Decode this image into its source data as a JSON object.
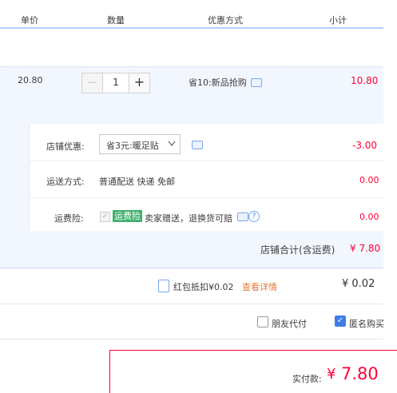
{
  "header": {
    "col_price": "单价",
    "col_qty": "数量",
    "col_discount": "优惠方式",
    "col_subtotal": "小计"
  },
  "item": {
    "price": "20.80",
    "qty": "1",
    "minus": "—",
    "plus": "+",
    "promo": "省10:新品抢购",
    "subtotal": "10.80"
  },
  "shop_discount": {
    "label": "店铺优惠:",
    "selected": "省3元:暖足贴",
    "value": "-3.00"
  },
  "shipping": {
    "label": "运送方式:",
    "method": "普通配送 快递 免邮",
    "value": "0.00"
  },
  "insurance": {
    "label": "运费险:",
    "badge": "运费险",
    "desc": "卖家赠送，退换货可赔",
    "value": "0.00"
  },
  "shop_total": {
    "label": "店铺合计(含运费)",
    "value": "¥ 7.80"
  },
  "red_envelope": {
    "label": "红包抵扣¥0.02",
    "details_link": "查看详情",
    "value": "¥ 0.02"
  },
  "options": {
    "friend_pay": "朋友代付",
    "anonymous": "匿名购买"
  },
  "payment": {
    "label": "实付款:",
    "currency": "¥",
    "amount": "7.80"
  },
  "colors": {
    "accent": "#ff0036",
    "blue": "#3f7ee8",
    "green_badge": "#3eb16b"
  }
}
